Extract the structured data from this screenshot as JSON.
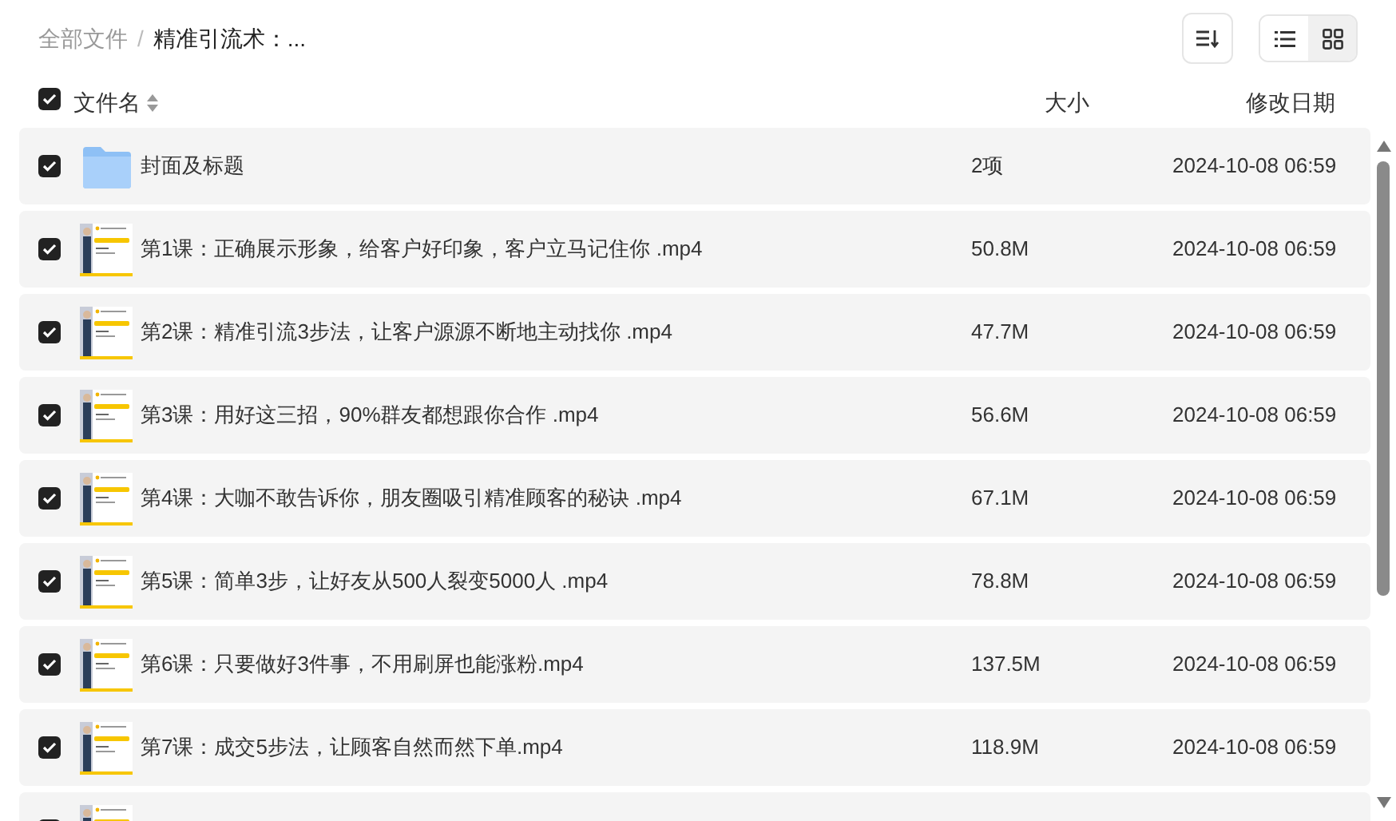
{
  "breadcrumb_separator": "/",
  "breadcrumb": [
    {
      "label": "全部文件",
      "current": false
    },
    {
      "label": "精准引流术：...",
      "current": true
    }
  ],
  "view_modes": [
    {
      "kind": "list",
      "selected": true
    },
    {
      "kind": "grid",
      "selected": false
    }
  ],
  "header": {
    "select_all_checked": true,
    "columns": [
      "文件名",
      "大小",
      "修改日期"
    ]
  },
  "rows": [
    {
      "kind": "folder",
      "checked": true,
      "name": "封面及标题",
      "size": "2项",
      "date": "2024-10-08 06:59"
    },
    {
      "kind": "video",
      "checked": true,
      "name": "第1课：正确展示形象，给客户好印象，客户立马记住你 .mp4",
      "size": "50.8M",
      "date": "2024-10-08 06:59"
    },
    {
      "kind": "video",
      "checked": true,
      "name": "第2课：精准引流3步法，让客户源源不断地主动找你 .mp4",
      "size": "47.7M",
      "date": "2024-10-08 06:59"
    },
    {
      "kind": "video",
      "checked": true,
      "name": "第3课：用好这三招，90%群友都想跟你合作 .mp4",
      "size": "56.6M",
      "date": "2024-10-08 06:59"
    },
    {
      "kind": "video",
      "checked": true,
      "name": "第4课：大咖不敢告诉你，朋友圈吸引精准顾客的秘诀 .mp4",
      "size": "67.1M",
      "date": "2024-10-08 06:59"
    },
    {
      "kind": "video",
      "checked": true,
      "name": "第5课：简单3步，让好友从500人裂变5000人 .mp4",
      "size": "78.8M",
      "date": "2024-10-08 06:59"
    },
    {
      "kind": "video",
      "checked": true,
      "name": "第6课：只要做好3件事，不用刷屏也能涨粉.mp4",
      "size": "137.5M",
      "date": "2024-10-08 06:59"
    },
    {
      "kind": "video",
      "checked": true,
      "name": "第7课：成交5步法，让顾客自然而然下单.mp4",
      "size": "118.9M",
      "date": "2024-10-08 06:59"
    },
    {
      "kind": "video",
      "checked": true
    }
  ]
}
